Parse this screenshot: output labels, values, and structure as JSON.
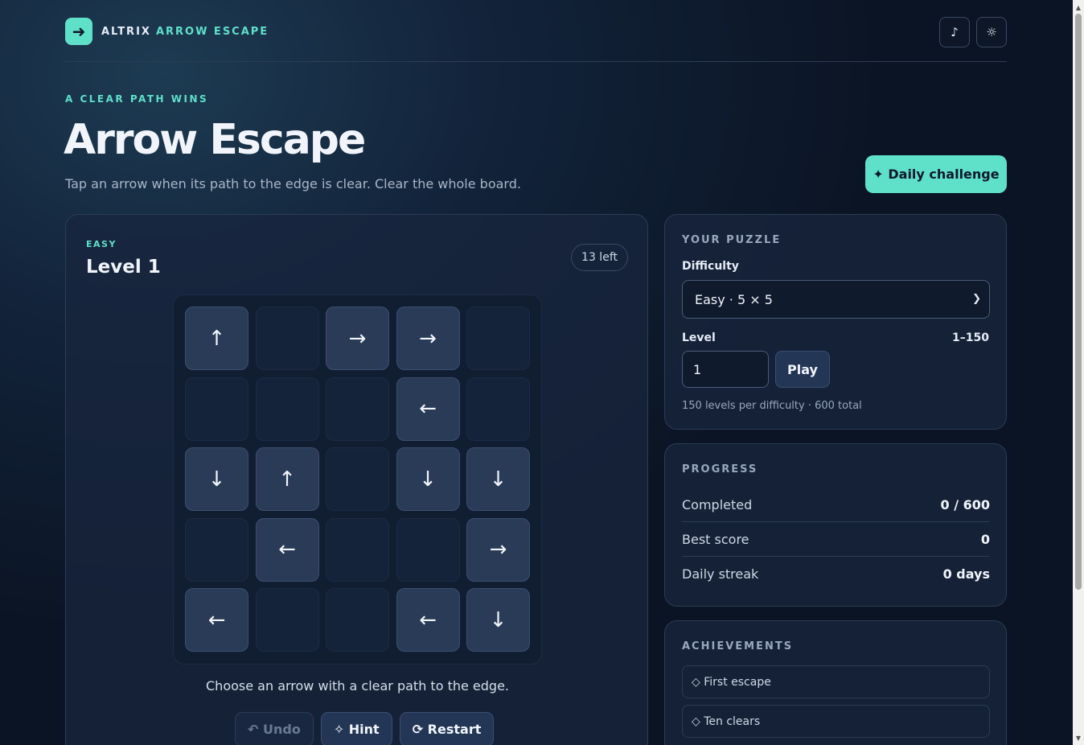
{
  "header": {
    "logo_glyph": "➜",
    "brand_primary": "ALTRIX",
    "brand_secondary": "ARROW ESCAPE",
    "music_icon": "♪",
    "theme_icon": "☼"
  },
  "hero": {
    "eyebrow": "A CLEAR PATH WINS",
    "title": "Arrow Escape",
    "subtitle": "Tap an arrow when its path to the edge is clear. Clear the whole board.",
    "daily_button": "✦ Daily challenge"
  },
  "board": {
    "difficulty_tag": "EASY",
    "level_title": "Level 1",
    "remaining": "13 left",
    "grid": [
      [
        "↑",
        "",
        "→",
        "→",
        ""
      ],
      [
        "",
        "",
        "",
        "←",
        ""
      ],
      [
        "↓",
        "↑",
        "",
        "↓",
        "↓"
      ],
      [
        "",
        "←",
        "",
        "",
        "→"
      ],
      [
        "←",
        "",
        "",
        "←",
        "↓"
      ]
    ],
    "status": "Choose an arrow with a clear path to the edge.",
    "actions": {
      "undo": "↶ Undo",
      "hint": "✧ Hint",
      "restart": "⟳ Restart"
    }
  },
  "puzzle": {
    "heading": "YOUR PUZZLE",
    "difficulty_label": "Difficulty",
    "difficulty_value": "Easy · 5 × 5",
    "level_label": "Level",
    "level_range": "1–150",
    "level_value": "1",
    "play_button": "Play",
    "note": "150 levels per difficulty · 600 total"
  },
  "progress": {
    "heading": "PROGRESS",
    "rows": [
      {
        "label": "Completed",
        "value": "0 / 600"
      },
      {
        "label": "Best score",
        "value": "0"
      },
      {
        "label": "Daily streak",
        "value": "0 days"
      }
    ]
  },
  "achievements": {
    "heading": "ACHIEVEMENTS",
    "items": [
      {
        "label": "◇ First escape"
      },
      {
        "label": "◇ Ten clears"
      }
    ]
  },
  "colors": {
    "accent": "#5fe0c9",
    "background": "#12233a",
    "tile": "#2a3b57"
  }
}
